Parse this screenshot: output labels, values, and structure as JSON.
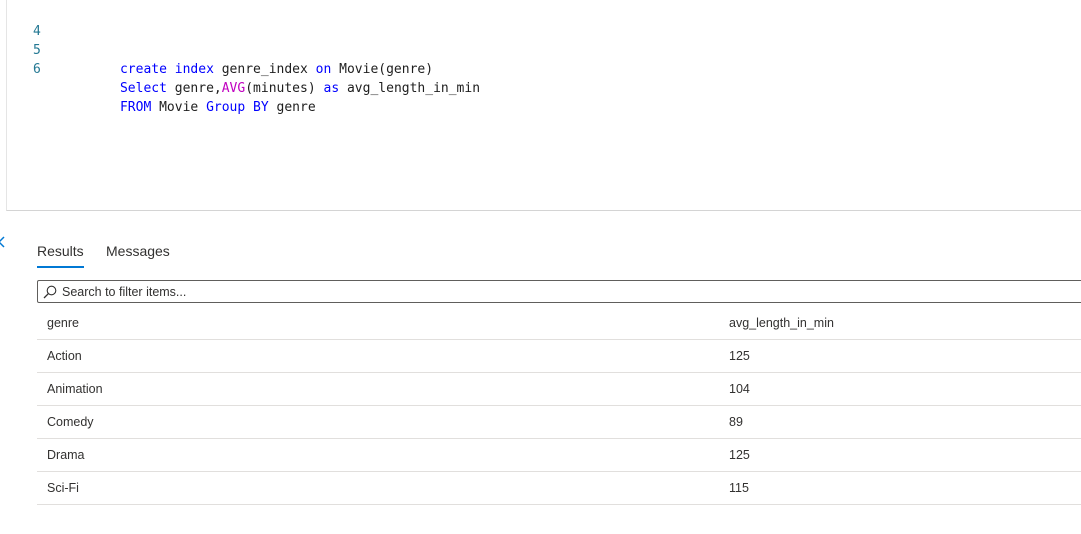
{
  "editor": {
    "lines": [
      {
        "number": "4",
        "tokens": [
          {
            "text": "create",
            "kind": "kw"
          },
          {
            "text": " ",
            "kind": "id"
          },
          {
            "text": "index",
            "kind": "kw"
          },
          {
            "text": " genre_index ",
            "kind": "id"
          },
          {
            "text": "on",
            "kind": "kw"
          },
          {
            "text": " Movie(genre)",
            "kind": "id"
          }
        ]
      },
      {
        "number": "5",
        "tokens": [
          {
            "text": "Select",
            "kind": "kw"
          },
          {
            "text": " genre,",
            "kind": "id"
          },
          {
            "text": "AVG",
            "kind": "fn"
          },
          {
            "text": "(minutes) ",
            "kind": "id"
          },
          {
            "text": "as",
            "kind": "kw"
          },
          {
            "text": " avg_length_in_min",
            "kind": "id"
          }
        ]
      },
      {
        "number": "6",
        "tokens": [
          {
            "text": "FROM",
            "kind": "kw"
          },
          {
            "text": " Movie ",
            "kind": "id"
          },
          {
            "text": "Group",
            "kind": "kw"
          },
          {
            "text": " ",
            "kind": "id"
          },
          {
            "text": "BY",
            "kind": "kw"
          },
          {
            "text": " genre",
            "kind": "id"
          }
        ]
      }
    ],
    "colors": {
      "keyword": "#0000ff",
      "function": "#c000c0",
      "line_number": "#237893"
    }
  },
  "results_panel": {
    "tabs": [
      {
        "label": "Results",
        "active": true
      },
      {
        "label": "Messages",
        "active": false
      }
    ],
    "filter": {
      "placeholder": "Search to filter items...",
      "value": ""
    },
    "columns": [
      "genre",
      "avg_length_in_min"
    ],
    "rows": [
      [
        "Action",
        "125"
      ],
      [
        "Animation",
        "104"
      ],
      [
        "Comedy",
        "89"
      ],
      [
        "Drama",
        "125"
      ],
      [
        "Sci-Fi",
        "115"
      ]
    ],
    "accent_color": "#0078d4"
  }
}
